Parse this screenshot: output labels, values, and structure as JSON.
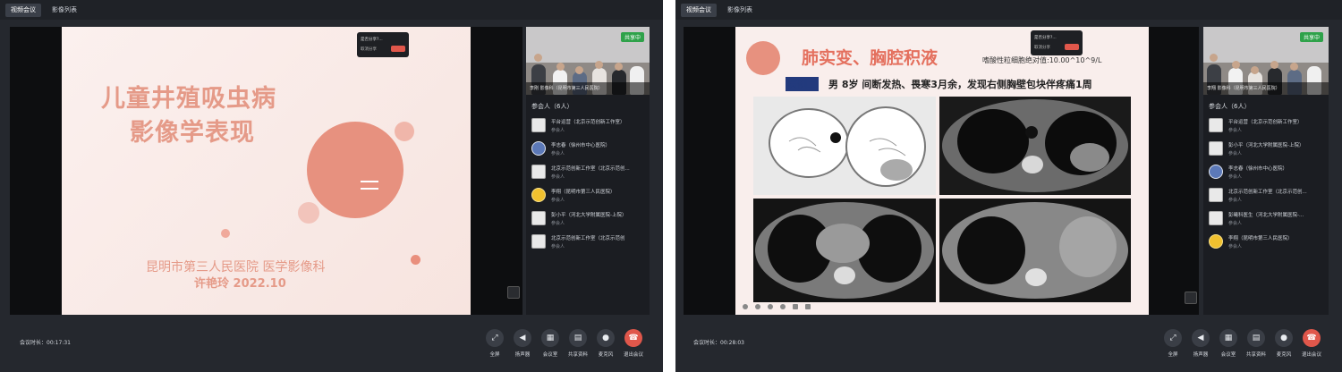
{
  "left": {
    "tabs": [
      "视频会议",
      "影像列表"
    ],
    "slide": {
      "title_line1": "儿童井殖吸虫病",
      "title_line2": "影像学表现",
      "institution": "昆明市第三人民医院 医学影像科",
      "author_date": "许艳玲  2022.10"
    },
    "tooltip": {
      "line1": "是否分享?...",
      "line2": "取消分享"
    },
    "camera_caption": "李刚  影像科（昆明市第三人民医院）",
    "share_badge": "共享中",
    "participants_title": "参会人（6人）",
    "participants": [
      {
        "name": "平台运营（北京示范创新工作室）",
        "role": "参会人",
        "avatar": "default"
      },
      {
        "name": "李志春（徐州市中心医院）",
        "role": "参会人",
        "avatar": "photo"
      },
      {
        "name": "北京示范创新工作室（北京示范创...",
        "role": "参会人",
        "avatar": "default"
      },
      {
        "name": "李翔（昆明市第三人民医院）",
        "role": "参会人",
        "avatar": "emoji"
      },
      {
        "name": "彭小平（河北大学附属医院-上院）",
        "role": "参会人",
        "avatar": "default"
      },
      {
        "name": "北京示范创新工作室（北京示范创",
        "role": "参会人",
        "avatar": "default"
      }
    ],
    "duration": "会议时长：00:17:31",
    "controls": [
      "全屏",
      "扬声器",
      "会议室",
      "共享资料",
      "麦克风",
      "退出会议"
    ]
  },
  "right": {
    "tabs": [
      "视频会议",
      "影像列表"
    ],
    "slide": {
      "title": "肺实变、胸腔积液",
      "lab": "嗜酸性粒细胞绝对值:10.00^10^9/L",
      "case_prefix": "病例二",
      "case_text": "男  8岁  间断发热、畏寒3月余，发现右侧胸壁包块伴疼痛1周"
    },
    "tooltip": {
      "line1": "是否分享?...",
      "line2": "取消分享"
    },
    "camera_caption": "李翔  影像科（昆明市第三人民医院）",
    "share_badge": "共享中",
    "participants_title": "参会人（6人）",
    "participants": [
      {
        "name": "平台运营（北京示范创新工作室）",
        "role": "参会人",
        "avatar": "default"
      },
      {
        "name": "彭小平（河北大学附属医院-上院）",
        "role": "参会人",
        "avatar": "default"
      },
      {
        "name": "李志春（徐州市中心医院）",
        "role": "参会人",
        "avatar": "photo"
      },
      {
        "name": "北京示范创新工作室（北京示范创...",
        "role": "参会人",
        "avatar": "default"
      },
      {
        "name": "彭曦科医生（河北大学附属医院-...",
        "role": "参会人",
        "avatar": "default"
      },
      {
        "name": "李翔（昆明市第三人民医院）",
        "role": "参会人",
        "avatar": "emoji"
      }
    ],
    "duration": "会议时长：00:28:03",
    "controls": [
      "全屏",
      "扬声器",
      "会议室",
      "共享资料",
      "麦克风",
      "退出会议"
    ]
  },
  "colors": {
    "accent_red": "#e0574b",
    "share_green": "#2fa24a",
    "title_salmon": "#e59a88"
  },
  "icons": {
    "fullscreen": "expand-icon",
    "speaker": "speaker-icon",
    "room": "grid-icon",
    "share": "document-icon",
    "mic": "microphone-icon",
    "leave": "phone-hangup-icon"
  }
}
